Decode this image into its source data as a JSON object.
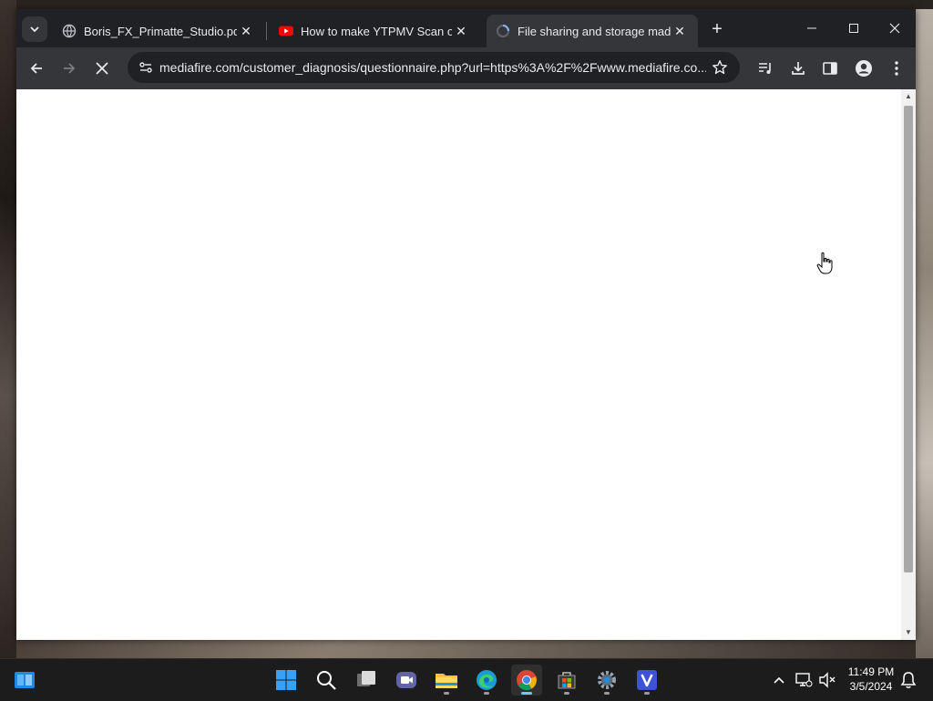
{
  "browser": {
    "tabs": [
      {
        "title": "Boris_FX_Primatte_Studio.pdf",
        "icon": "globe-icon",
        "active": false
      },
      {
        "title": "How to make YTPMV Scan on S",
        "icon": "youtube-icon",
        "active": false
      },
      {
        "title": "File sharing and storage made s",
        "icon": "loading-icon",
        "active": true
      }
    ],
    "address": "mediafire.com/customer_diagnosis/questionnaire.php?url=https%3A%2F%2Fwww.mediafire.co..."
  },
  "taskbar": {
    "time": "11:49 PM",
    "date": "3/5/2024",
    "apps": [
      "start-icon",
      "search-icon",
      "task-view-icon",
      "video-call-icon",
      "file-explorer-icon",
      "edge-icon",
      "chrome-icon",
      "store-icon",
      "settings-icon",
      "v-app-icon"
    ]
  },
  "colors": {
    "tabbar": "#202124",
    "toolbar": "#35363a",
    "taskbar": "#1c1c1c",
    "accent": "#60cdff"
  }
}
